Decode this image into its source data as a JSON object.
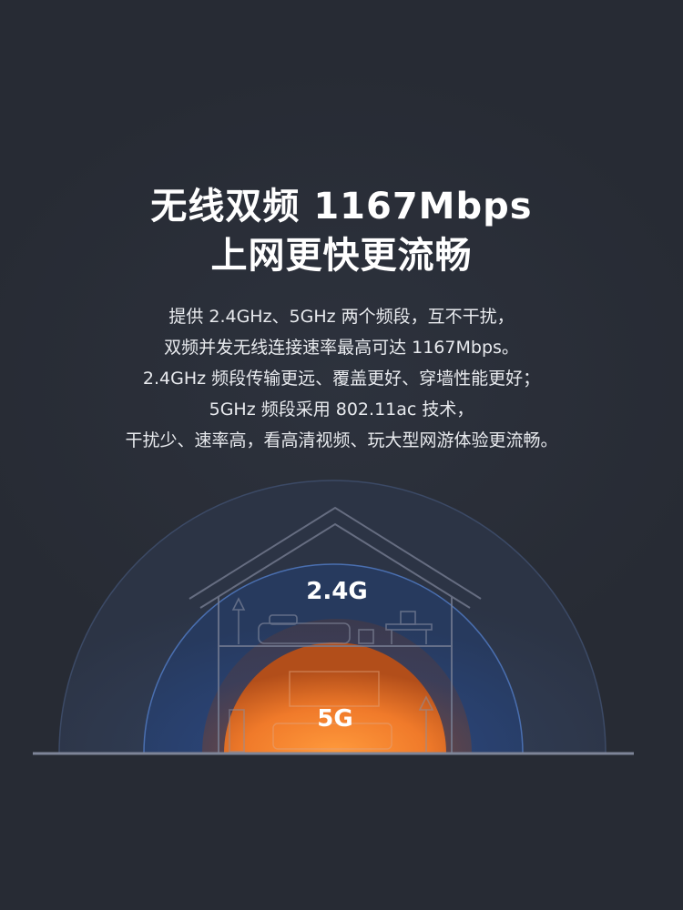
{
  "headline": {
    "line1": "无线双频 1167Mbps",
    "line2": "上网更快更流畅"
  },
  "description": [
    "提供 2.4GHz、5GHz 两个频段，互不干扰，",
    "双频并发无线连接速率最高可达 1167Mbps。",
    "2.4GHz 频段传输更远、覆盖更好、穿墙性能更好；",
    "5GHz 频段采用 802.11ac 技术，",
    "干扰少、速率高，看高清视频、玩大型网游体验更流畅。"
  ],
  "illustration": {
    "band_outer_label": "2.4G",
    "band_inner_label": "5G",
    "colors": {
      "background": "#272b34",
      "outer_arc": "#2b3f66",
      "mid_arc": "#3a5ea0",
      "core_orange": "#f07a2a",
      "core_glow": "#c85a1c"
    }
  }
}
